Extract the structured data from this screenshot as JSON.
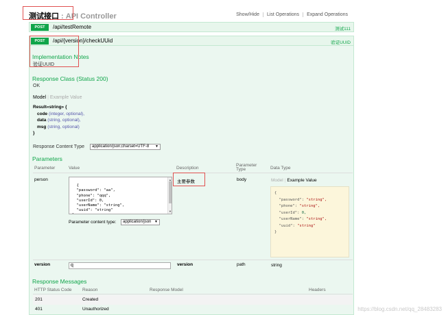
{
  "header": {
    "title_cn": "测试接口",
    "title_sep": " : ",
    "title_en": "API Controller",
    "links": [
      "Show/Hide",
      "List Operations",
      "Expand Operations"
    ]
  },
  "operations": [
    {
      "method": "POST",
      "path": "/api/testRemote",
      "summary": "测试111"
    },
    {
      "method": "POST",
      "path": "/api/{version}/checkUUid",
      "summary": "验证UUID"
    }
  ],
  "impl_notes": {
    "heading": "Implementation Notes",
    "text": "验证UUID"
  },
  "response_class": {
    "heading": "Response Class (Status 200)",
    "status_text": "OK",
    "model_tab": "Model",
    "separator": "|",
    "example_tab": "Example Value",
    "signature": {
      "head": "Result«string» {",
      "fields": [
        {
          "name": "code",
          "type": "(integer, optional),"
        },
        {
          "name": "data",
          "type": "(string, optional),"
        },
        {
          "name": "msg",
          "type": "(string, optional)"
        }
      ],
      "close": "}"
    }
  },
  "response_content_type": {
    "label": "Response Content Type",
    "value": "application/json;charset=UTF-8"
  },
  "parameters": {
    "heading": "Parameters",
    "columns": [
      "Parameter",
      "Value",
      "Description",
      "Parameter Type",
      "Data Type"
    ],
    "rows": [
      {
        "name": "person",
        "json_value": "{\n  \"password\": \"aa\",\n  \"phone\": \"qqq\",\n  \"userId\": 0,\n  \"userName\": \"string\",\n  \"uuid\": \"string\"\n}",
        "description": "主要参数",
        "param_type": "body",
        "content_type_label": "Parameter content type:",
        "content_type_value": "application/json",
        "model_tab": "Model",
        "example_tab": "Example Value"
      },
      {
        "name": "version",
        "value": "q",
        "description": "version",
        "param_type": "path",
        "data_type": "string"
      }
    ]
  },
  "data_type_example": {
    "open": "{",
    "lines": [
      {
        "key": "\"password\": ",
        "val": "\"string\",",
        "kind": "str"
      },
      {
        "key": "\"phone\": ",
        "val": "\"string\",",
        "kind": "str"
      },
      {
        "key": "\"userId\": ",
        "val": "0,",
        "kind": "num"
      },
      {
        "key": "\"userName\": ",
        "val": "\"string\",",
        "kind": "str"
      },
      {
        "key": "\"uuid\": ",
        "val": "\"string\"",
        "kind": "str"
      }
    ],
    "close": "}"
  },
  "response_messages": {
    "heading": "Response Messages",
    "columns": [
      "HTTP Status Code",
      "Reason",
      "Response Model",
      "Headers"
    ],
    "rows": [
      {
        "code": "201",
        "reason": "Created"
      },
      {
        "code": "401",
        "reason": "Unauthorized"
      }
    ]
  },
  "watermark": "https://blog.csdn.net/qq_28483283",
  "colors": {
    "post_green": "#10a54a",
    "panel_bg": "#ebf7f0",
    "example_bg": "#fcf6db",
    "annotation_red": "#e05050"
  }
}
